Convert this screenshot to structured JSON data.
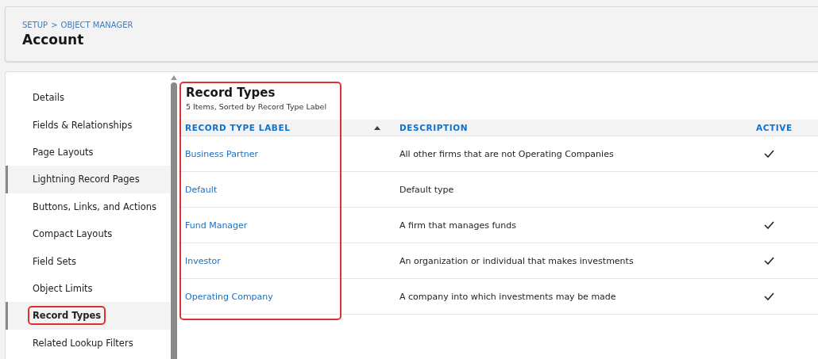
{
  "header": {
    "breadcrumb": [
      "SETUP",
      "OBJECT MANAGER"
    ],
    "breadcrumb_separator": ">",
    "title": "Account"
  },
  "sidebar": {
    "items": [
      {
        "label": "Details",
        "selected": false,
        "highlighted": false,
        "annotated": false
      },
      {
        "label": "Fields & Relationships",
        "selected": false,
        "highlighted": false,
        "annotated": false
      },
      {
        "label": "Page Layouts",
        "selected": false,
        "highlighted": false,
        "annotated": false
      },
      {
        "label": "Lightning Record Pages",
        "selected": false,
        "highlighted": true,
        "annotated": false
      },
      {
        "label": "Buttons, Links, and Actions",
        "selected": false,
        "highlighted": false,
        "annotated": false
      },
      {
        "label": "Compact Layouts",
        "selected": false,
        "highlighted": false,
        "annotated": false
      },
      {
        "label": "Field Sets",
        "selected": false,
        "highlighted": false,
        "annotated": false
      },
      {
        "label": "Object Limits",
        "selected": false,
        "highlighted": false,
        "annotated": false
      },
      {
        "label": "Record Types",
        "selected": true,
        "highlighted": true,
        "annotated": true
      },
      {
        "label": "Related Lookup Filters",
        "selected": false,
        "highlighted": false,
        "annotated": false
      }
    ]
  },
  "section": {
    "title": "Record Types",
    "subtitle": "5 Items, Sorted by Record Type Label",
    "annotated": true
  },
  "table": {
    "columns": [
      {
        "label": "RECORD TYPE LABEL",
        "sorted": true
      },
      {
        "label": "DESCRIPTION",
        "sorted": false
      },
      {
        "label": "ACTIVE",
        "sorted": false
      }
    ],
    "rows": [
      {
        "label": "Business Partner",
        "description": "All other firms that are not Operating Companies",
        "active": true
      },
      {
        "label": "Default",
        "description": "Default type",
        "active": false
      },
      {
        "label": "Fund Manager",
        "description": "A firm that manages funds",
        "active": true
      },
      {
        "label": "Investor",
        "description": "An organization or individual that makes investments",
        "active": true
      },
      {
        "label": "Operating Company",
        "description": "A company into which investments may be made",
        "active": true
      }
    ]
  }
}
